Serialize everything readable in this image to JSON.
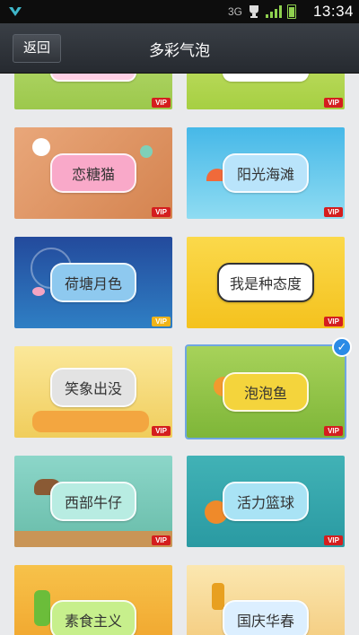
{
  "status_bar": {
    "time": "13:34",
    "network": "3G",
    "icons": [
      "app-logo-icon",
      "trophy-icon",
      "signal-icon",
      "battery-icon"
    ]
  },
  "nav": {
    "back_label": "返回",
    "title": "多彩气泡"
  },
  "badge_label": "VIP",
  "tiles": [
    {
      "name": "",
      "vip": true
    },
    {
      "name": "",
      "vip": true
    },
    {
      "name": "恋糖猫",
      "vip": true
    },
    {
      "name": "阳光海滩",
      "vip": true
    },
    {
      "name": "荷塘月色",
      "vip": true
    },
    {
      "name": "我是种态度",
      "vip": true
    },
    {
      "name": "笑象出没",
      "vip": true
    },
    {
      "name": "泡泡鱼",
      "vip": true,
      "selected": true
    },
    {
      "name": "西部牛仔",
      "vip": true
    },
    {
      "name": "活力篮球",
      "vip": true
    },
    {
      "name": "素食主义",
      "vip": false
    },
    {
      "name": "国庆华春",
      "vip": false
    }
  ],
  "colors": {
    "selected_check": "#2b8be6",
    "vip_badge": "#d41e1e"
  }
}
